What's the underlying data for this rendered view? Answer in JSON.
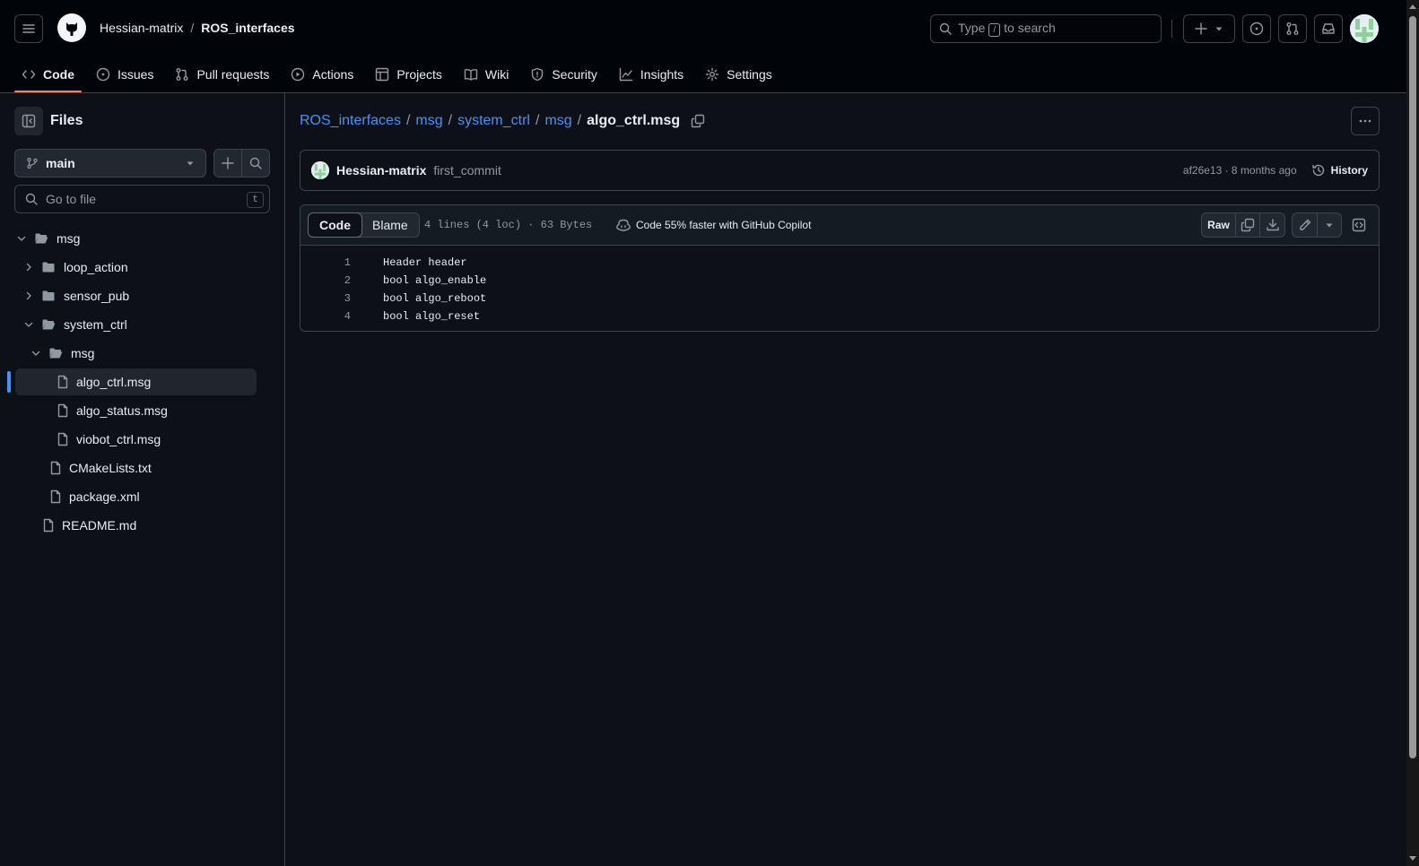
{
  "header": {
    "owner": "Hessian-matrix",
    "separator": "/",
    "repo": "ROS_interfaces",
    "search": {
      "prefix": "Type",
      "key": "/",
      "suffix": "to search"
    }
  },
  "nav": {
    "tabs": [
      {
        "label": "Code",
        "icon": "code-icon",
        "active": true
      },
      {
        "label": "Issues",
        "icon": "issue-icon"
      },
      {
        "label": "Pull requests",
        "icon": "pull-request-icon"
      },
      {
        "label": "Actions",
        "icon": "play-icon"
      },
      {
        "label": "Projects",
        "icon": "table-icon"
      },
      {
        "label": "Wiki",
        "icon": "book-icon"
      },
      {
        "label": "Security",
        "icon": "shield-icon"
      },
      {
        "label": "Insights",
        "icon": "graph-icon"
      },
      {
        "label": "Settings",
        "icon": "gear-icon"
      }
    ]
  },
  "sidebar": {
    "title": "Files",
    "branch": "main",
    "go_to_file_placeholder": "Go to file",
    "go_to_file_key": "t",
    "tree": [
      {
        "label": "msg",
        "type": "folder",
        "open": true,
        "depth": 0
      },
      {
        "label": "loop_action",
        "type": "folder",
        "open": false,
        "depth": 1
      },
      {
        "label": "sensor_pub",
        "type": "folder",
        "open": false,
        "depth": 1
      },
      {
        "label": "system_ctrl",
        "type": "folder",
        "open": true,
        "depth": 1
      },
      {
        "label": "msg",
        "type": "folder",
        "open": true,
        "depth": 2
      },
      {
        "label": "algo_ctrl.msg",
        "type": "file",
        "depth": 3,
        "selected": true
      },
      {
        "label": "algo_status.msg",
        "type": "file",
        "depth": 3
      },
      {
        "label": "viobot_ctrl.msg",
        "type": "file",
        "depth": 3
      },
      {
        "label": "CMakeLists.txt",
        "type": "file",
        "depth": 2
      },
      {
        "label": "package.xml",
        "type": "file",
        "depth": 2
      },
      {
        "label": "README.md",
        "type": "file",
        "depth": 1
      }
    ]
  },
  "main": {
    "breadcrumb": {
      "parts": [
        "ROS_interfaces",
        "msg",
        "system_ctrl",
        "msg"
      ],
      "separator": "/",
      "current": "algo_ctrl.msg"
    },
    "commit": {
      "author": "Hessian-matrix",
      "message": "first_commit",
      "meta": "af26e13 · 8 months ago",
      "history_label": "History"
    },
    "code": {
      "tab_code": "Code",
      "tab_blame": "Blame",
      "file_info": "4 lines (4 loc) · 63 Bytes",
      "copilot_promo": "Code 55% faster with GitHub Copilot",
      "raw_label": "Raw",
      "lines": [
        {
          "num": "1",
          "text": "Header header"
        },
        {
          "num": "2",
          "text": "bool algo_enable"
        },
        {
          "num": "3",
          "text": "bool algo_reboot"
        },
        {
          "num": "4",
          "text": "bool algo_reset"
        }
      ]
    }
  },
  "colors": {
    "background": "#0d1117",
    "header_bg": "#010409",
    "border": "#3d444d",
    "link": "#4493f8",
    "active_underline": "#f78166",
    "muted": "#9198a1"
  }
}
